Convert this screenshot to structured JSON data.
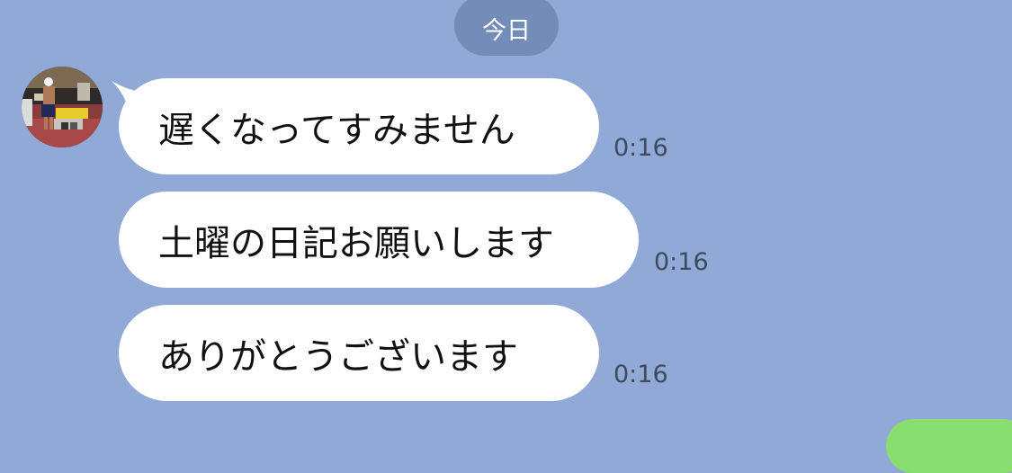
{
  "date_separator": "今日",
  "messages": [
    {
      "text": "遅くなってすみません",
      "time": "0:16"
    },
    {
      "text": "土曜の日記お願いします",
      "time": "0:16"
    },
    {
      "text": "ありがとうございます",
      "time": "0:16"
    }
  ],
  "colors": {
    "background": "#90a9d6",
    "bubble_received": "#ffffff",
    "bubble_sent": "#88de6f",
    "date_pill": "#6f86b3"
  },
  "icons": {
    "avatar": "avatar-photo-icon"
  }
}
